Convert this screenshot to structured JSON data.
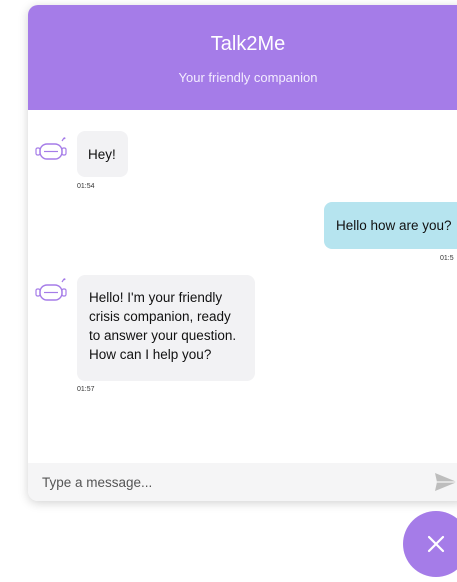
{
  "header": {
    "title": "Talk2Me",
    "subtitle": "Your friendly companion"
  },
  "messages": [
    {
      "sender": "bot",
      "lines": [
        "Hey!"
      ],
      "time": "01:54"
    },
    {
      "sender": "user",
      "lines": [
        "Hello how are you?"
      ],
      "time": "01:5"
    },
    {
      "sender": "bot",
      "lines": [
        "Hello! I'm your friendly",
        "crisis companion, ready",
        "to answer your question.",
        "How can I help you?"
      ],
      "time": "01:57"
    }
  ],
  "input": {
    "placeholder": "Type a message...",
    "value": ""
  },
  "icons": {
    "bot_avatar": "robot-icon",
    "send": "send-icon",
    "close": "close-icon"
  },
  "colors": {
    "accent": "#a57ce8",
    "user_bubble": "#b6e4ef",
    "bot_bubble": "#f2f2f4"
  }
}
